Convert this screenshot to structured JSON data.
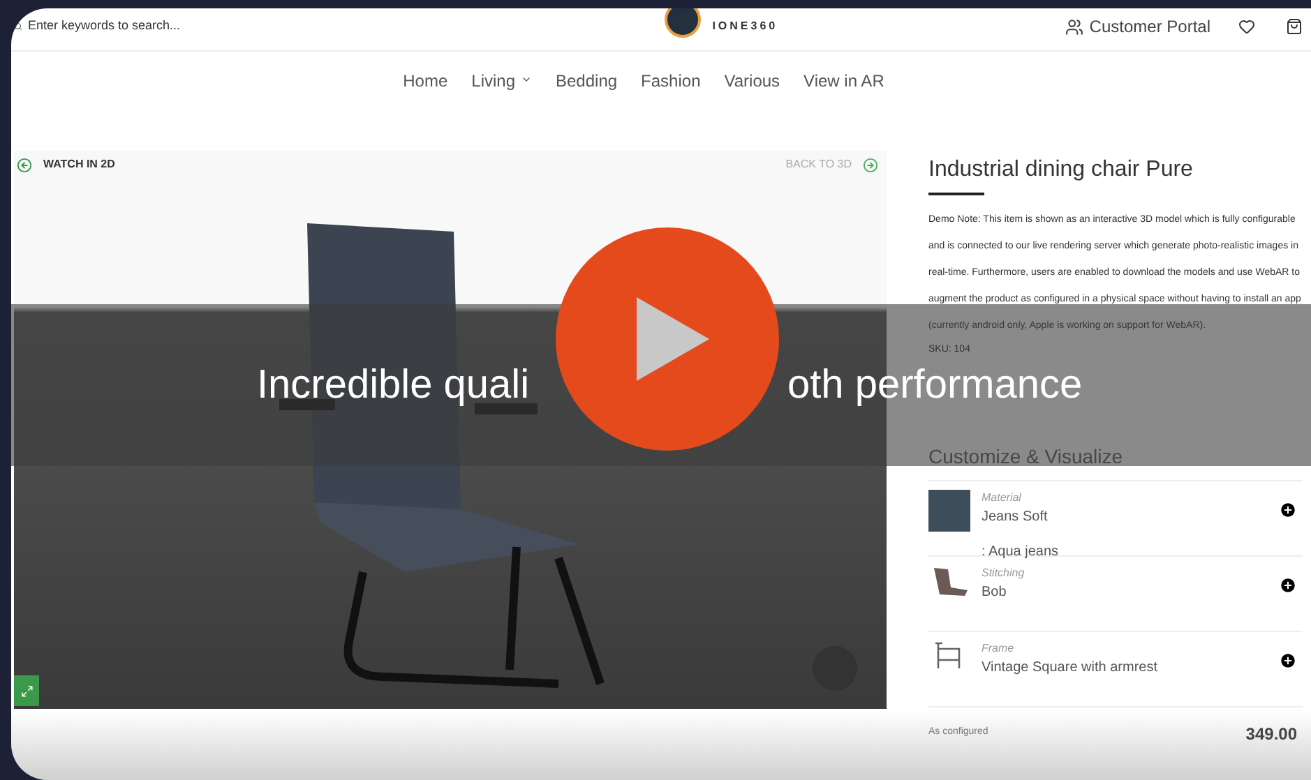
{
  "header": {
    "search": {
      "placeholder": "Enter keywords to search..."
    },
    "brand": "IONE360",
    "portal_link": "Customer Portal"
  },
  "nav": [
    {
      "label": "Home",
      "has_menu": false
    },
    {
      "label": "Living",
      "has_menu": true
    },
    {
      "label": "Bedding",
      "has_menu": false
    },
    {
      "label": "Fashion",
      "has_menu": false
    },
    {
      "label": "Various",
      "has_menu": false
    },
    {
      "label": "View in AR",
      "has_menu": false
    }
  ],
  "viewer": {
    "left_link": "WATCH IN 2D",
    "right_link": "BACK TO 3D"
  },
  "product": {
    "title": "Industrial dining chair Pure",
    "description": "Demo Note: This item is shown as an interactive 3D model which is fully configurable and is connected to our live rendering server which generate photo-realistic images in real-time. Furthermore, users are enabled to download the models and use WebAR to augment the product as configured in a physical space without having to install an app (currently android only, Apple is working on support for WebAR).",
    "sku": "SKU: 104",
    "section_title": "Customize & Visualize",
    "options": [
      {
        "kind": "swatch",
        "label": "Material",
        "value": "Jeans Soft",
        "note": ": Aqua jeans"
      },
      {
        "kind": "photo",
        "label": "Stitching",
        "value": "Bob"
      },
      {
        "kind": "frame",
        "label": "Frame",
        "value": "Vintage Square with armrest"
      }
    ],
    "price_label": "As configured",
    "price": "349.00"
  },
  "video": {
    "caption_before": "Incredible quali",
    "caption_after": "oth performance"
  }
}
